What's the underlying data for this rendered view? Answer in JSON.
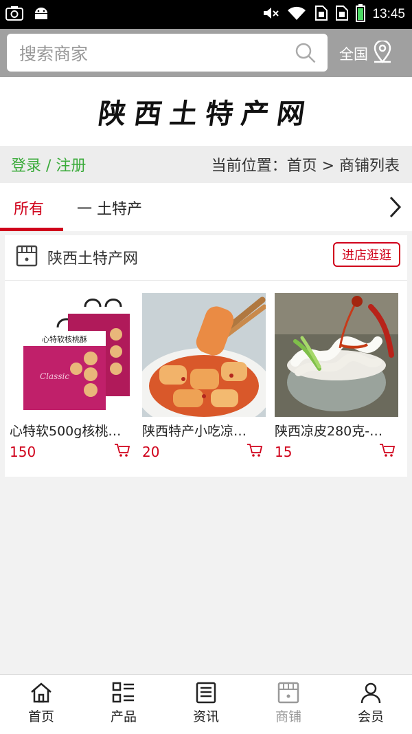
{
  "status_bar": {
    "time": "13:45"
  },
  "search": {
    "placeholder": "搜索商家",
    "region_label": "全国"
  },
  "site_title": "陕西土特产网",
  "crumb": {
    "login_link": "登录 / 注册",
    "breadcrumb": "当前位置：首页 > 商铺列表"
  },
  "tabs": {
    "all": "所有",
    "category": "一 土特产"
  },
  "shop": {
    "name": "陕西土特产网",
    "visit_button": "进店逛逛",
    "products": [
      {
        "title": "心特软500g核桃…",
        "price": "150"
      },
      {
        "title": "陕西特产小吃凉…",
        "price": "20"
      },
      {
        "title": "陕西凉皮280克-…",
        "price": "15"
      }
    ]
  },
  "bottom_nav": [
    {
      "label": "首页",
      "icon": "home-icon"
    },
    {
      "label": "产品",
      "icon": "grid-list-icon"
    },
    {
      "label": "资讯",
      "icon": "news-icon"
    },
    {
      "label": "商铺",
      "icon": "store-icon"
    },
    {
      "label": "会员",
      "icon": "user-icon"
    }
  ],
  "colors": {
    "accent_red": "#d0021b",
    "login_green": "#3bab3b",
    "header_gray": "#a0a0a0"
  }
}
